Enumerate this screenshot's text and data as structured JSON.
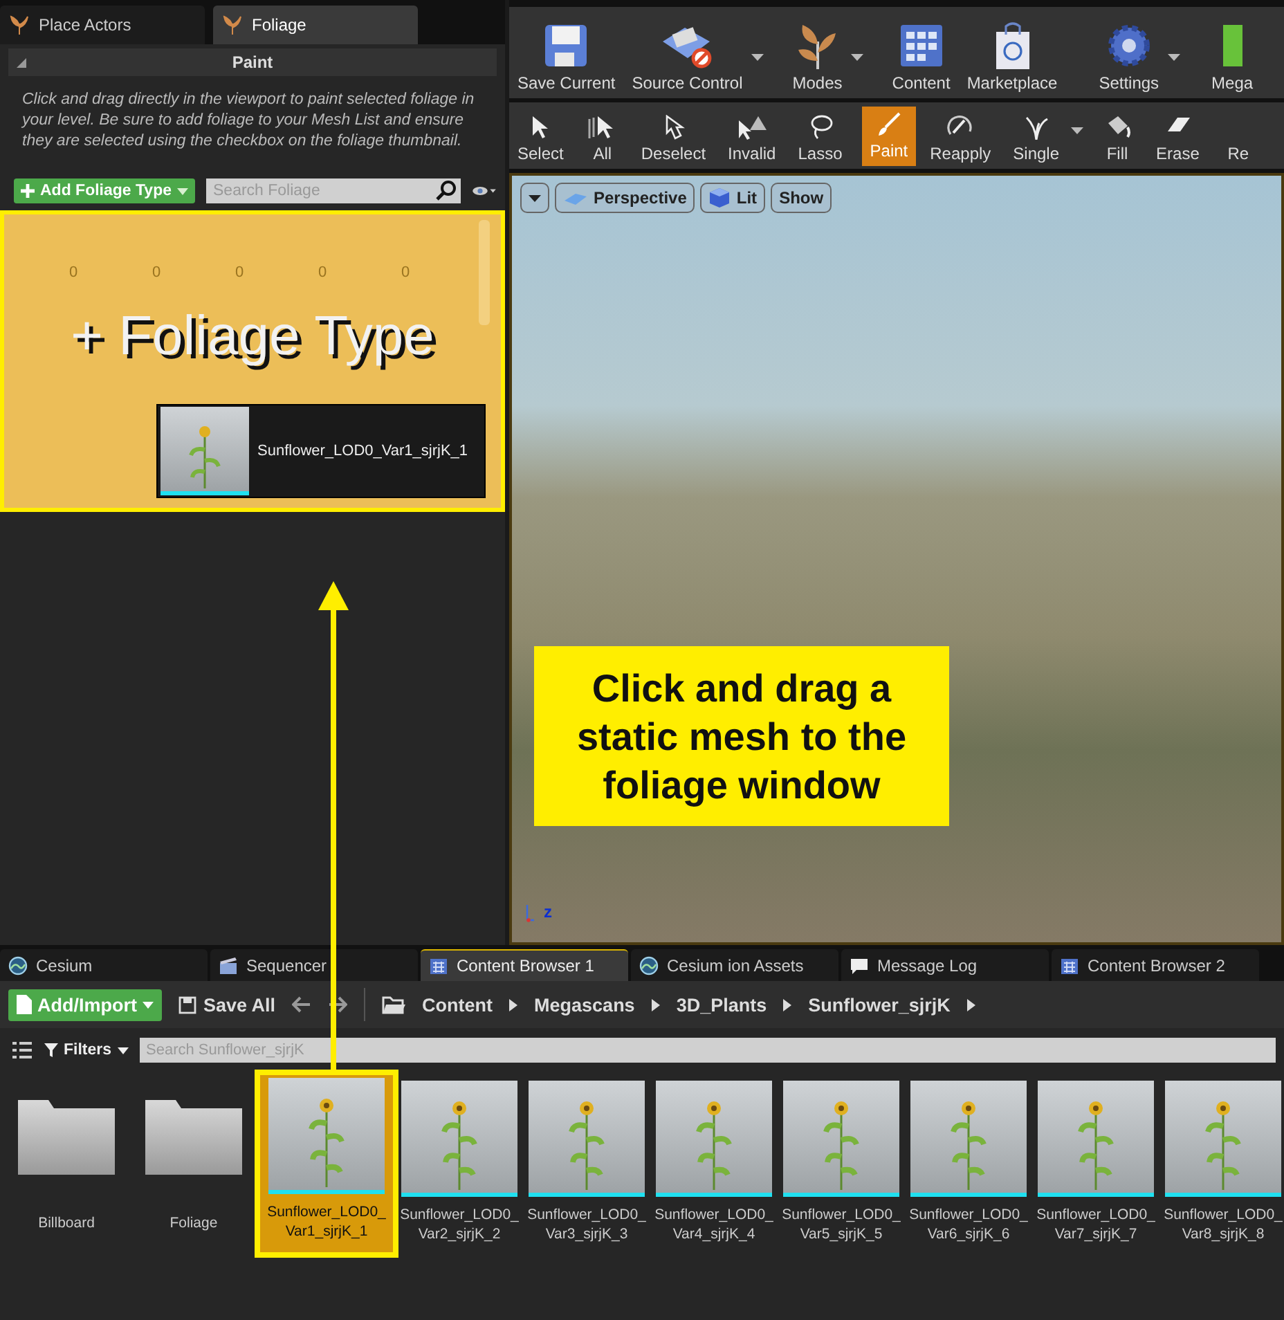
{
  "left_panel": {
    "tabs": [
      {
        "label": "Place Actors",
        "selected": false
      },
      {
        "label": "Foliage",
        "selected": true
      }
    ],
    "section": {
      "title": "Paint",
      "expanded": true,
      "description": "Click and drag directly in the viewport to paint selected foliage in your level. Be sure to add foliage to your Mesh List and ensure they are selected using the checkbox on the foliage thumbnail."
    },
    "add_button": "Add Foliage Type",
    "search": {
      "placeholder": "Search Foliage"
    },
    "drop_zone": {
      "cell_counts": [
        "0",
        "0",
        "0",
        "0",
        "0"
      ],
      "label": "+ Foliage Type",
      "dragged_item": "Sunflower_LOD0_Var1_sjrjK_1"
    }
  },
  "main_toolbar": [
    {
      "kind": "save",
      "label": "Save Current",
      "dropdown": false
    },
    {
      "kind": "source",
      "label": "Source Control",
      "dropdown": true
    },
    {
      "kind": "modes",
      "label": "Modes",
      "dropdown": true
    },
    {
      "kind": "content",
      "label": "Content",
      "dropdown": false
    },
    {
      "kind": "market",
      "label": "Marketplace",
      "dropdown": false
    },
    {
      "kind": "settings",
      "label": "Settings",
      "dropdown": true
    },
    {
      "kind": "mega",
      "label": "Mega",
      "dropdown": false
    }
  ],
  "mode_toolbar": [
    {
      "kind": "select",
      "label": "Select",
      "selected": false,
      "dropdown": false
    },
    {
      "kind": "all",
      "label": "All",
      "selected": false,
      "dropdown": false
    },
    {
      "kind": "deselect",
      "label": "Deselect",
      "selected": false,
      "dropdown": false
    },
    {
      "kind": "invalid",
      "label": "Invalid",
      "selected": false,
      "dropdown": false
    },
    {
      "kind": "lasso",
      "label": "Lasso",
      "selected": false,
      "dropdown": false
    },
    {
      "kind": "paint",
      "label": "Paint",
      "selected": true,
      "dropdown": false
    },
    {
      "kind": "reapply",
      "label": "Reapply",
      "selected": false,
      "dropdown": false
    },
    {
      "kind": "single",
      "label": "Single",
      "selected": false,
      "dropdown": true
    },
    {
      "kind": "fill",
      "label": "Fill",
      "selected": false,
      "dropdown": false
    },
    {
      "kind": "erase",
      "label": "Erase",
      "selected": false,
      "dropdown": false
    },
    {
      "kind": "cut",
      "label": "Re",
      "selected": false,
      "dropdown": false
    }
  ],
  "viewport": {
    "buttons": [
      {
        "kind": "view",
        "label": "Perspective"
      },
      {
        "kind": "lit",
        "label": "Lit"
      },
      {
        "kind": "plain",
        "label": "Show"
      }
    ],
    "callout": {
      "lines": [
        "Click and drag a",
        "static mesh to the",
        "foliage window"
      ]
    },
    "axis_label": "z"
  },
  "bottom_tabs": [
    {
      "kind": "globe",
      "label": "Cesium",
      "selected": false
    },
    {
      "kind": "seq",
      "label": "Sequencer",
      "selected": false
    },
    {
      "kind": "grid",
      "label": "Content Browser 1",
      "selected": true
    },
    {
      "kind": "globe",
      "label": "Cesium ion Assets",
      "selected": false
    },
    {
      "kind": "msg",
      "label": "Message Log",
      "selected": false
    },
    {
      "kind": "grid",
      "label": "Content Browser 2",
      "selected": false
    }
  ],
  "content_browser": {
    "add_button": "Add/Import",
    "save_button": "Save All",
    "path": [
      "Content",
      "Megascans",
      "3D_Plants",
      "Sunflower_sjrjK"
    ],
    "filters": "Filters",
    "search": {
      "placeholder": "Search Sunflower_sjrjK"
    },
    "assets": [
      {
        "kind": "folder",
        "name": "Billboard",
        "selected": false
      },
      {
        "kind": "folder",
        "name": "Foliage",
        "selected": false
      },
      {
        "kind": "mesh",
        "name": "Sunflower_LOD0_Var1_sjrjK_1",
        "selected": true
      },
      {
        "kind": "mesh",
        "name": "Sunflower_LOD0_Var2_sjrjK_2",
        "selected": false
      },
      {
        "kind": "mesh",
        "name": "Sunflower_LOD0_Var3_sjrjK_3",
        "selected": false
      },
      {
        "kind": "mesh",
        "name": "Sunflower_LOD0_Var4_sjrjK_4",
        "selected": false
      },
      {
        "kind": "mesh",
        "name": "Sunflower_LOD0_Var5_sjrjK_5",
        "selected": false
      },
      {
        "kind": "mesh",
        "name": "Sunflower_LOD0_Var6_sjrjK_6",
        "selected": false
      },
      {
        "kind": "mesh",
        "name": "Sunflower_LOD0_Var7_sjrjK_7",
        "selected": false
      },
      {
        "kind": "mesh",
        "name": "Sunflower_LOD0_Var8_sjrjK_8",
        "selected": false
      }
    ]
  }
}
